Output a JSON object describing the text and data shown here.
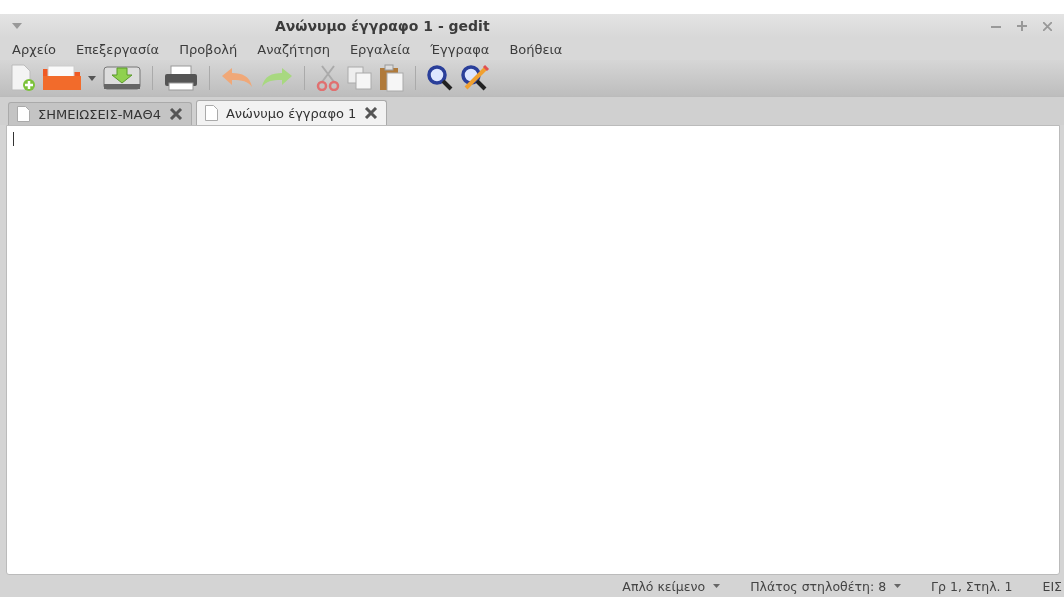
{
  "window": {
    "title": "Ανώνυμο έγγραφο 1 - gedit"
  },
  "menu": [
    "Αρχείο",
    "Επεξεργασία",
    "Προβολή",
    "Αναζήτηση",
    "Εργαλεία",
    "Έγγραφα",
    "Βοήθεια"
  ],
  "toolbar": [
    {
      "kind": "new"
    },
    {
      "kind": "open"
    },
    {
      "kind": "dropdown"
    },
    {
      "kind": "save"
    },
    {
      "kind": "sep"
    },
    {
      "kind": "print"
    },
    {
      "kind": "sep"
    },
    {
      "kind": "undo"
    },
    {
      "kind": "redo"
    },
    {
      "kind": "sep"
    },
    {
      "kind": "cut"
    },
    {
      "kind": "copy"
    },
    {
      "kind": "paste"
    },
    {
      "kind": "sep"
    },
    {
      "kind": "find"
    },
    {
      "kind": "replace"
    }
  ],
  "tabs": [
    {
      "label": "ΣΗΜΕΙΩΣΕΙΣ-ΜΑΘ4",
      "selected": false
    },
    {
      "label": "Ανώνυμο έγγραφο 1",
      "selected": true
    }
  ],
  "status_bar": [
    {
      "kind": "dropdown",
      "text": "Απλό κείμενο"
    },
    {
      "kind": "dropdown",
      "text": "Πλάτος στηλοθέτη:  8"
    },
    {
      "kind": "text",
      "text": "Γρ 1, Στηλ. 1"
    },
    {
      "kind": "text",
      "text": "ΕΙΣ"
    }
  ]
}
